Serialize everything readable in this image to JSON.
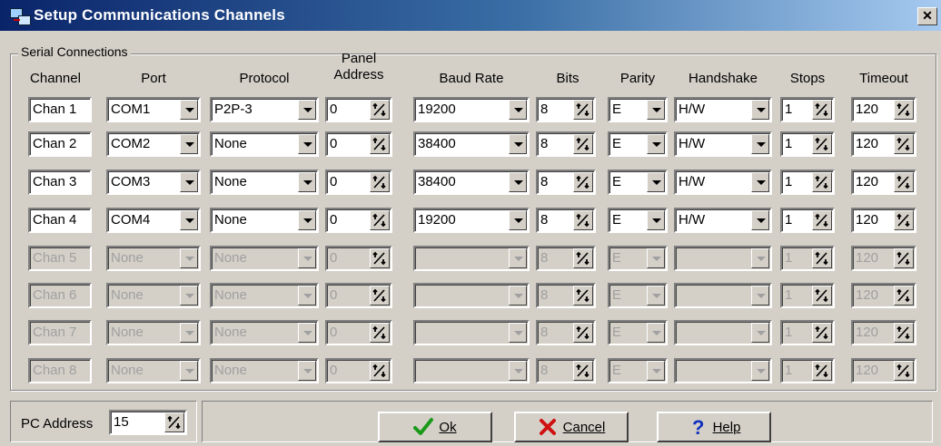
{
  "window": {
    "title": "Setup Communications Channels",
    "close_glyph": "✕"
  },
  "group": {
    "legend": "Serial Connections"
  },
  "headers": {
    "channel": "Channel",
    "port": "Port",
    "protocol": "Protocol",
    "panel_address_line1": "Panel",
    "panel_address_line2": "Address",
    "baud_rate": "Baud Rate",
    "bits": "Bits",
    "parity": "Parity",
    "handshake": "Handshake",
    "stops": "Stops",
    "timeout": "Timeout"
  },
  "rows": [
    {
      "channel": "Chan 1",
      "port": "COM1",
      "protocol": "P2P-3",
      "panel_address": "0",
      "baud_rate": "19200",
      "bits": "8",
      "parity": "E",
      "handshake": "H/W",
      "stops": "1",
      "timeout": "120",
      "enabled": true
    },
    {
      "channel": "Chan 2",
      "port": "COM2",
      "protocol": "None",
      "panel_address": "0",
      "baud_rate": "38400",
      "bits": "8",
      "parity": "E",
      "handshake": "H/W",
      "stops": "1",
      "timeout": "120",
      "enabled": true
    },
    {
      "channel": "Chan 3",
      "port": "COM3",
      "protocol": "None",
      "panel_address": "0",
      "baud_rate": "38400",
      "bits": "8",
      "parity": "E",
      "handshake": "H/W",
      "stops": "1",
      "timeout": "120",
      "enabled": true
    },
    {
      "channel": "Chan 4",
      "port": "COM4",
      "protocol": "None",
      "panel_address": "0",
      "baud_rate": "19200",
      "bits": "8",
      "parity": "E",
      "handshake": "H/W",
      "stops": "1",
      "timeout": "120",
      "enabled": true
    },
    {
      "channel": "Chan 5",
      "port": "None",
      "protocol": "None",
      "panel_address": "0",
      "baud_rate": "",
      "bits": "8",
      "parity": "E",
      "handshake": "",
      "stops": "1",
      "timeout": "120",
      "enabled": false
    },
    {
      "channel": "Chan 6",
      "port": "None",
      "protocol": "None",
      "panel_address": "0",
      "baud_rate": "",
      "bits": "8",
      "parity": "E",
      "handshake": "",
      "stops": "1",
      "timeout": "120",
      "enabled": false
    },
    {
      "channel": "Chan 7",
      "port": "None",
      "protocol": "None",
      "panel_address": "0",
      "baud_rate": "",
      "bits": "8",
      "parity": "E",
      "handshake": "",
      "stops": "1",
      "timeout": "120",
      "enabled": false
    },
    {
      "channel": "Chan 8",
      "port": "None",
      "protocol": "None",
      "panel_address": "0",
      "baud_rate": "",
      "bits": "8",
      "parity": "E",
      "handshake": "",
      "stops": "1",
      "timeout": "120",
      "enabled": false
    }
  ],
  "footer": {
    "pc_address_label": "PC Address",
    "pc_address_value": "15",
    "ok_label": "Ok",
    "cancel_label": "Cancel",
    "help_label": "Help"
  },
  "icons": {
    "spin": "spin-arrows-icon",
    "dropdown": "dropdown-arrow-icon",
    "ok": "checkmark-icon",
    "cancel": "red-x-icon",
    "help": "question-mark-icon",
    "app": "network-computers-icon"
  },
  "colors": {
    "title_start": "#0a246a",
    "title_end": "#a6caf0",
    "face": "#d4d0c8",
    "ok_icon": "#1a9a1a",
    "cancel_icon": "#d01010",
    "help_icon": "#1030c0"
  }
}
